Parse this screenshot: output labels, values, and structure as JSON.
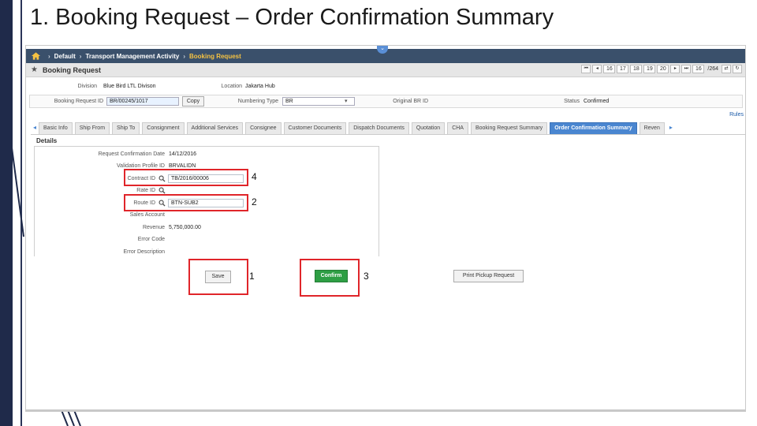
{
  "slide": {
    "title": "1. Booking Request – Order Confirmation Summary"
  },
  "breadcrumb": {
    "items": [
      "Default",
      "Transport Management Activity",
      "Booking Request"
    ]
  },
  "window": {
    "title": "Booking Request",
    "pager": {
      "boxes": [
        "16",
        "17",
        "18",
        "19",
        "20"
      ],
      "current": "16",
      "total": "/264"
    }
  },
  "header_form": {
    "division_label": "Division",
    "division_value": "Blue Bird LTL Divison",
    "location_label": "Location",
    "location_value": "Jakarta Hub",
    "booking_id_label": "Booking Request ID",
    "booking_id_value": "BR/00245/1017",
    "copy_label": "Copy",
    "numbering_type_label": "Numbering Type",
    "numbering_type_value": "BR",
    "original_br_label": "Original BR ID",
    "status_label": "Status",
    "status_value": "Confirmed"
  },
  "rules_link": "Rules",
  "tabs": [
    {
      "label": "Basic Info"
    },
    {
      "label": "Ship From"
    },
    {
      "label": "Ship To"
    },
    {
      "label": "Consignment"
    },
    {
      "label": "Additional Services"
    },
    {
      "label": "Consignee"
    },
    {
      "label": "Customer Documents"
    },
    {
      "label": "Dispatch Documents"
    },
    {
      "label": "Quotation"
    },
    {
      "label": "CHA"
    },
    {
      "label": "Booking Request Summary"
    },
    {
      "label": "Order Confirmation Summary"
    },
    {
      "label": "Reven"
    }
  ],
  "details": {
    "heading": "Details",
    "request_confirmation_date_label": "Request Confirmation Date",
    "request_confirmation_date_value": "14/12/2016",
    "validation_profile_label": "Validation Profile ID",
    "validation_profile_value": "BRVALIDN",
    "contract_id_label": "Contract ID",
    "contract_id_value": "TB/2016/00006",
    "rate_id_label": "Rate ID",
    "route_id_label": "Route ID",
    "route_id_value": "BTN-SUB2",
    "sales_account_label": "Sales Account",
    "revenue_label": "Revenue",
    "revenue_value": "5,750,000.00",
    "error_code_label": "Error Code",
    "error_description_label": "Error Description"
  },
  "actions": {
    "save_label": "Save",
    "confirm_label": "Confirm",
    "print_label": "Print Pickup Request"
  },
  "callouts": {
    "contract": "4",
    "route": "2",
    "save": "1",
    "confirm": "3"
  },
  "colors": {
    "highlight": "#e0252a",
    "confirm_button": "#2e9e44",
    "active_tab": "#4a86d0",
    "breadcrumb_bar": "#3a506b"
  }
}
